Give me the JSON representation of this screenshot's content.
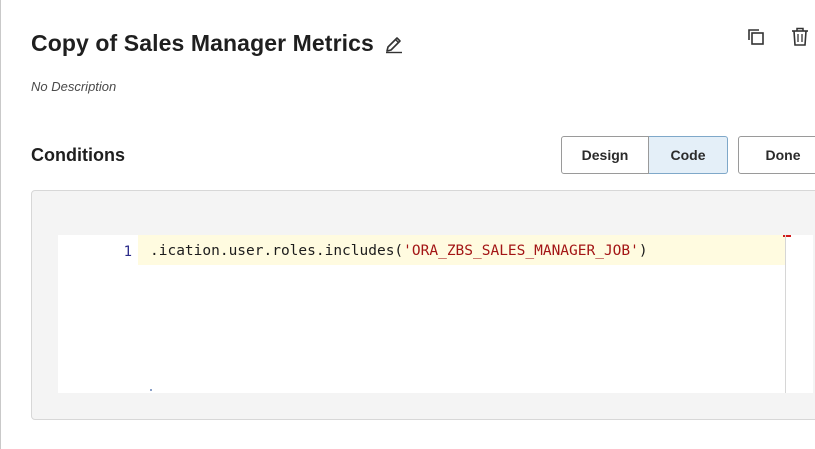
{
  "header": {
    "title": "Copy of Sales Manager Metrics",
    "description": "No Description"
  },
  "icons": {
    "edit": "pencil-icon",
    "copy": "duplicate-icon",
    "delete": "trash-icon"
  },
  "conditions": {
    "heading": "Conditions",
    "buttons": {
      "design": "Design",
      "code": "Code",
      "done": "Done"
    },
    "editor": {
      "line_number": "1",
      "code_prefix": "​.ication.user.roles.includes(",
      "code_string": "'ORA_ZBS_SALES_MANAGER_JOB'",
      "code_suffix": ")"
    }
  },
  "colors": {
    "active_toggle_bg": "#e4eff8",
    "string_color": "#a31515",
    "current_line_bg": "#fffbe0"
  }
}
